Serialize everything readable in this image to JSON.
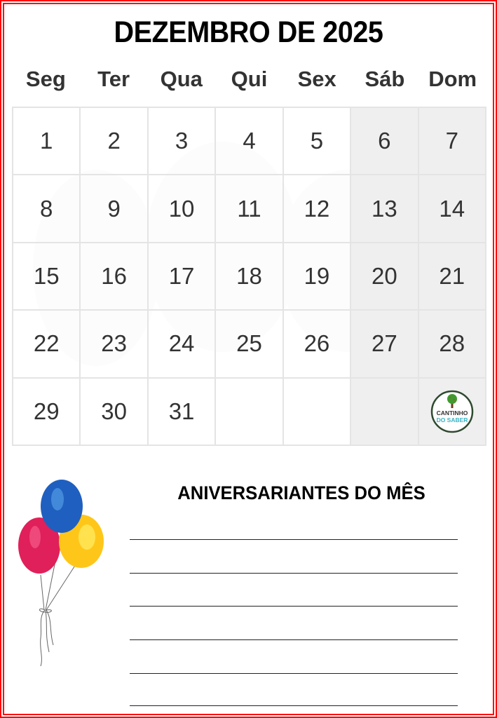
{
  "calendar": {
    "title": "DEZEMBRO DE 2025",
    "weekdays": [
      "Seg",
      "Ter",
      "Qua",
      "Qui",
      "Sex",
      "Sáb",
      "Dom"
    ],
    "weeks": [
      [
        "1",
        "2",
        "3",
        "4",
        "5",
        "6",
        "7"
      ],
      [
        "8",
        "9",
        "10",
        "11",
        "12",
        "13",
        "14"
      ],
      [
        "15",
        "16",
        "17",
        "18",
        "19",
        "20",
        "21"
      ],
      [
        "22",
        "23",
        "24",
        "25",
        "26",
        "27",
        "28"
      ],
      [
        "29",
        "30",
        "31",
        "",
        "",
        "",
        ""
      ]
    ],
    "weekend_color": "#efefef",
    "border_color": "#ff0000"
  },
  "logo": {
    "line1": "CANTINHO",
    "line2": "DO SABER",
    "line1_color": "#333333",
    "line2_color": "#3bb3c3",
    "ring_color": "#2f4a2f"
  },
  "birthdays": {
    "title": "ANIVERSARIANTES DO MÊS",
    "lines": [
      "",
      "",
      "",
      "",
      "",
      ""
    ]
  },
  "decoration": {
    "icon": "balloons-icon",
    "balloon_colors": [
      "#1f5fbf",
      "#e0205a",
      "#ffcf1a"
    ]
  }
}
